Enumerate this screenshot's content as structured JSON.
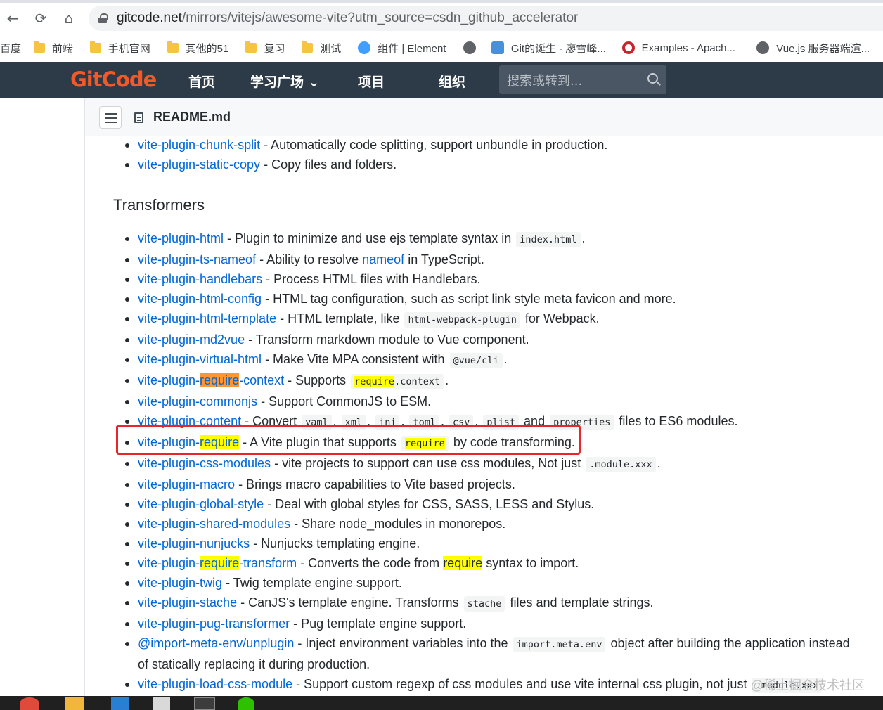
{
  "browser": {
    "url_main": "gitcode.net",
    "url_path": "/mirrors/vitejs/awesome-vite?utm_source=csdn_github_accelerator",
    "back_icon": "←",
    "reload_icon": "⟳",
    "home_icon": "⌂",
    "bookmarks": [
      {
        "label": "百度",
        "icon": "none"
      },
      {
        "label": "前端",
        "icon": "folder"
      },
      {
        "label": "手机官网",
        "icon": "folder"
      },
      {
        "label": "其他的51",
        "icon": "folder"
      },
      {
        "label": "复习",
        "icon": "folder"
      },
      {
        "label": "测试",
        "icon": "folder"
      },
      {
        "label": "组件 | Element",
        "icon": "shield"
      },
      {
        "label": "",
        "icon": "globe"
      },
      {
        "label": "Git的诞生 - 廖雪峰...",
        "icon": "rocket"
      },
      {
        "label": "Examples - Apach...",
        "icon": "ring"
      },
      {
        "label": "Vue.js 服务器端渲...",
        "icon": "globe"
      }
    ]
  },
  "gitcode": {
    "logo": "GitCode",
    "nav": [
      "首页",
      "学习广场 ⌄",
      "项目",
      "组织"
    ],
    "search_placeholder": "搜索或转到..."
  },
  "file": {
    "name": "README.md"
  },
  "readme": {
    "top_items": [
      {
        "link": "vite-plugin-chunk-split",
        "desc": " - Automatically code splitting, support unbundle in production."
      },
      {
        "link": "vite-plugin-static-copy",
        "desc": " - Copy files and folders."
      }
    ],
    "heading": "Transformers",
    "items": {
      "html": {
        "link": "vite-plugin-html",
        "desc": " - Plugin to minimize and use ejs template syntax in ",
        "code": "index.html",
        "tail": "."
      },
      "tsnameof": {
        "link": "vite-plugin-ts-nameof",
        "desc": " - Ability to resolve ",
        "link2": "nameof",
        "tail": " in TypeScript."
      },
      "handlebars": {
        "link": "vite-plugin-handlebars",
        "desc": " - Process HTML files with Handlebars."
      },
      "htmlconfig": {
        "link": "vite-plugin-html-config",
        "desc": " - HTML tag configuration, such as script link style meta favicon and more."
      },
      "htmltemplate": {
        "link": "vite-plugin-html-template",
        "desc": " - HTML template, like ",
        "code": "html-webpack-plugin",
        "tail": " for Webpack."
      },
      "md2vue": {
        "link": "vite-plugin-md2vue",
        "desc": " - Transform markdown module to Vue component."
      },
      "virtualhtml": {
        "link": "vite-plugin-virtual-html",
        "desc": " - Make Vite MPA consistent with ",
        "code": "@vue/cli",
        "tail": "."
      },
      "requirecontext": {
        "link_a": "vite-plugin-",
        "link_hl": "require",
        "link_b": "-context",
        "desc": " - Supports ",
        "code_hl": "require",
        "code_rest": ".context",
        "tail": "."
      },
      "commonjs": {
        "link": "vite-plugin-commonjs",
        "desc": " - Support CommonJS to ESM."
      },
      "content": {
        "link": "vite-plugin-content",
        "desc": " - Convert ",
        "codes": [
          "yaml",
          "xml",
          "ini",
          "toml",
          "csv",
          "plist"
        ],
        "and": " and ",
        "last_code": "properties",
        "tail": " files to ES6 modules."
      },
      "require": {
        "link_a": "vite-plugin-",
        "link_hl": "require",
        "desc": " - A Vite plugin that supports ",
        "code_hl": "require",
        "tail": " by code transforming."
      },
      "cssmodules": {
        "link": "vite-plugin-css-modules",
        "desc": " - vite projects to support can use css modules, Not just ",
        "code": ".module.xxx",
        "tail": "."
      },
      "macro": {
        "link": "vite-plugin-macro",
        "desc": " - Brings macro capabilities to Vite based projects."
      },
      "globalstyle": {
        "link": "vite-plugin-global-style",
        "desc": " - Deal with global styles for CSS, SASS, LESS and Stylus."
      },
      "sharedmodules": {
        "link": "vite-plugin-shared-modules",
        "desc": " - Share node_modules in monorepos."
      },
      "nunjucks": {
        "link": "vite-plugin-nunjucks",
        "desc": " - Nunjucks templating engine."
      },
      "requiretransform": {
        "link_a": "vite-plugin-",
        "link_hl": "require",
        "link_b": "-transform",
        "desc": " - Converts the code from ",
        "hl_word": "require",
        "tail": " syntax to import."
      },
      "twig": {
        "link": "vite-plugin-twig",
        "desc": " - Twig template engine support."
      },
      "stache": {
        "link": "vite-plugin-stache",
        "desc": " - CanJS's template engine. Transforms ",
        "code": "stache",
        "tail": " files and template strings."
      },
      "pug": {
        "link": "vite-plugin-pug-transformer",
        "desc": " - Pug template engine support."
      },
      "importmeta": {
        "link": "@import-meta-env/unplugin",
        "desc": " - Inject environment variables into the ",
        "code": "import.meta.env",
        "tail": " object after building the application instead",
        "cont": "of statically replacing it during production."
      },
      "loadcss": {
        "link": "vite-plugin-load-css-module",
        "desc": " - Support custom regexp of css modules and use vite internal css plugin, not just ",
        "code": ".module.xxx"
      }
    }
  },
  "watermark": "@稀土掘金技术社区"
}
